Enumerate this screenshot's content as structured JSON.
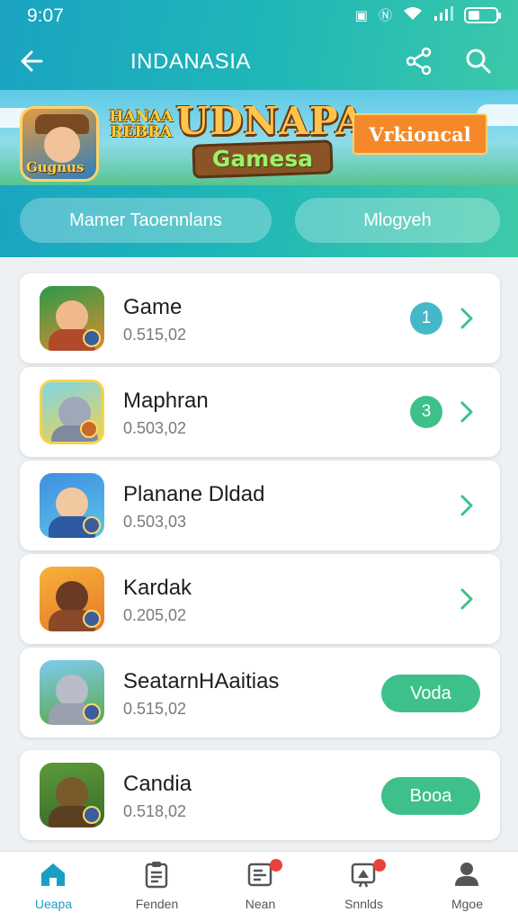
{
  "status_bar": {
    "time": "9:07"
  },
  "app_bar": {
    "title": "INDANASIA"
  },
  "banner": {
    "hero_label": "Gugnus",
    "small_text": "HANAA REBRA",
    "logo_title": "UDNAPA",
    "logo_subtitle": "Gamesa",
    "cta_label": "Vrkioncal"
  },
  "tabs": [
    {
      "label": "Mamer Taoennlans"
    },
    {
      "label": "Mlogyeh"
    }
  ],
  "colors": {
    "header_start": "#1aa3c2",
    "header_end": "#3fcaa8",
    "accent_green": "#3ec08a",
    "badge_teal": "#45b8c8",
    "active_nav": "#1a9fc4"
  },
  "games": [
    {
      "name": "Game",
      "meta": "0.515,02",
      "badge": "1",
      "badge_color": "#45b8c8",
      "action": null,
      "icon": "adventurer-game-icon"
    },
    {
      "name": "Maphran",
      "meta": "0.503,02",
      "badge": "3",
      "badge_color": "#3ec08a",
      "action": null,
      "icon": "creature-game-icon"
    },
    {
      "name": "Planane Dldad",
      "meta": "0.503,03",
      "badge": null,
      "action": null,
      "icon": "warrior-game-icon"
    },
    {
      "name": "Kardak",
      "meta": "0.205,02",
      "badge": null,
      "action": null,
      "icon": "animal-game-icon"
    },
    {
      "name": "SeatarnHAaitias",
      "meta": "0.515,02",
      "badge": null,
      "action": "Voda",
      "icon": "goat-game-icon"
    },
    {
      "name": "Candia",
      "meta": "0.518,02",
      "badge": null,
      "action": "Booa",
      "icon": "ogre-game-icon"
    }
  ],
  "bottom_nav": [
    {
      "label": "Ueapa",
      "icon": "home-icon",
      "active": true
    },
    {
      "label": "Fenden",
      "icon": "clipboard-icon",
      "active": false
    },
    {
      "label": "Nean",
      "icon": "news-icon",
      "active": false,
      "dot": true
    },
    {
      "label": "Snnlds",
      "icon": "rocket-icon",
      "active": false,
      "dot": true
    },
    {
      "label": "Mgoe",
      "icon": "profile-icon",
      "active": false
    }
  ]
}
